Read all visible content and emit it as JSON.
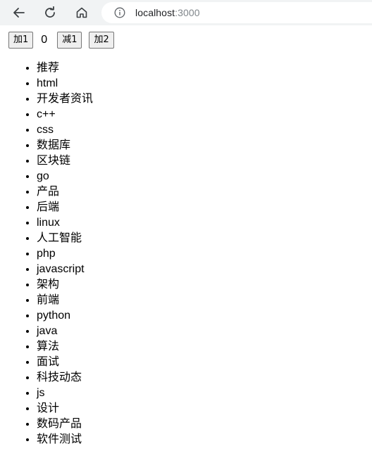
{
  "browser": {
    "url_host": "localhost",
    "url_port": ":3000",
    "icons": {
      "back": "back-arrow-icon",
      "reload": "reload-icon",
      "home": "home-icon",
      "info": "info-icon"
    }
  },
  "counter": {
    "add1_label": "加1",
    "value": "0",
    "sub1_label": "减1",
    "add2_label": "加2"
  },
  "tags": [
    "推荐",
    "html",
    "开发者资讯",
    "c++",
    "css",
    "数据库",
    "区块链",
    "go",
    "产品",
    "后端",
    "linux",
    "人工智能",
    "php",
    "javascript",
    "架构",
    "前端",
    "python",
    "java",
    "算法",
    "面试",
    "科技动态",
    "js",
    "设计",
    "数码产品",
    "软件测试"
  ]
}
